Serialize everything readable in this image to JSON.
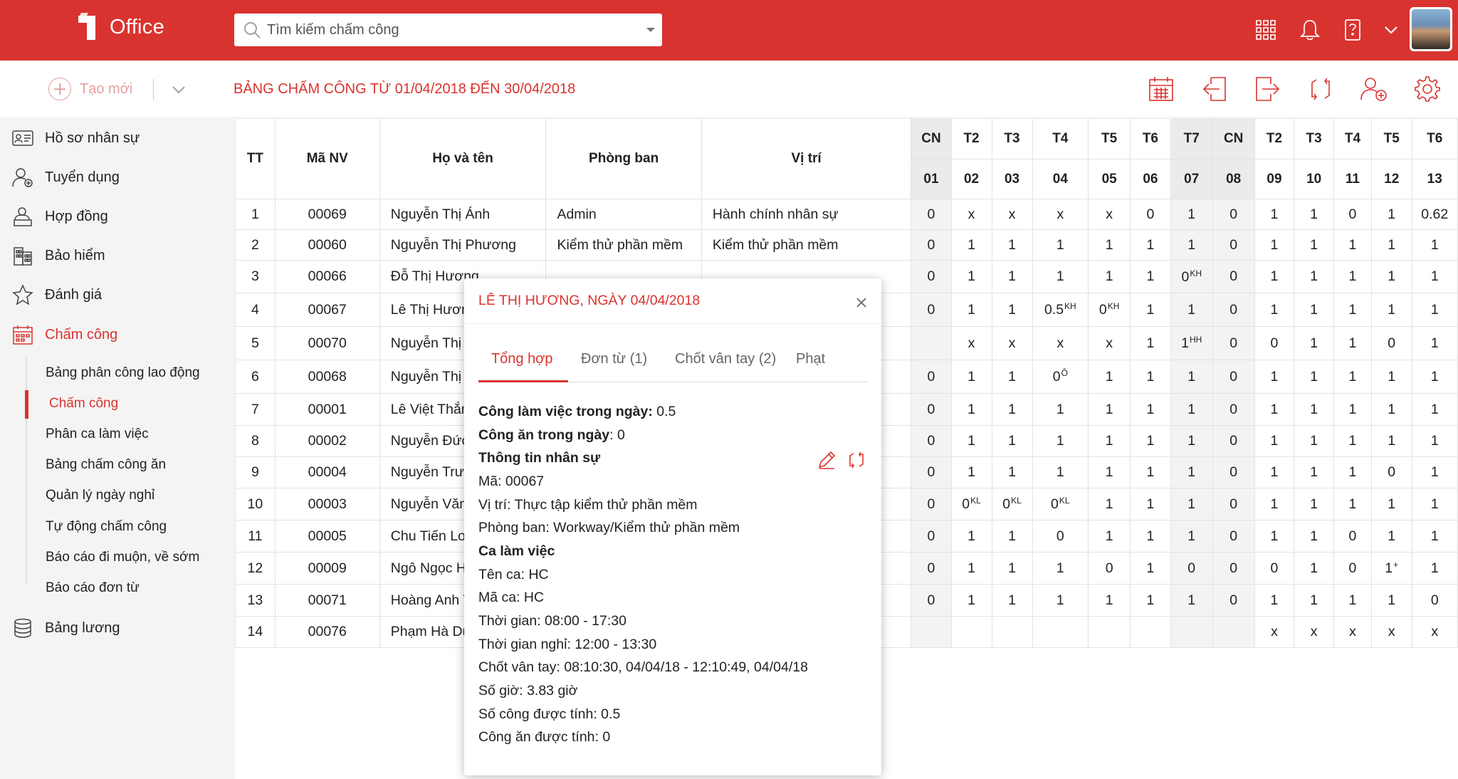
{
  "app": {
    "logo_text": "Office",
    "logo_mark": "1"
  },
  "colors": {
    "brand": "#d9332f",
    "sidebar_bg": "#f4f4f4",
    "weekend_bg": "#ebebeb"
  },
  "search": {
    "placeholder": "Tìm kiếm chấm công",
    "value": ""
  },
  "top_icons": [
    "apps-grid-icon",
    "bell-icon",
    "help-icon",
    "chevron-down-icon"
  ],
  "toolbar": {
    "create_label": "Tạo mới",
    "title": "BẢNG CHẤM CÔNG TỪ 01/04/2018 ĐẾN 30/04/2018",
    "icons": [
      "calendar-icon",
      "import-icon",
      "export-icon",
      "sync-icon",
      "add-user-icon",
      "gear-icon"
    ]
  },
  "sidebar": {
    "items": [
      {
        "label": "Hồ sơ nhân sự",
        "icon": "profile-card-icon"
      },
      {
        "label": "Tuyển dụng",
        "icon": "recruit-icon"
      },
      {
        "label": "Hợp đồng",
        "icon": "contract-icon"
      },
      {
        "label": "Bảo hiểm",
        "icon": "building-icon"
      },
      {
        "label": "Đánh giá",
        "icon": "star-icon"
      },
      {
        "label": "Chấm công",
        "icon": "calendar-icon"
      },
      {
        "label": "Bảng lương",
        "icon": "coins-icon"
      }
    ],
    "sub_items": [
      "Bảng phân công lao động",
      "Chấm công",
      "Phân ca làm việc",
      "Bảng chấm công ăn",
      "Quản lý ngày nghỉ",
      "Tự động chấm công",
      "Báo cáo đi muộn, về sớm",
      "Báo cáo đơn từ"
    ]
  },
  "table": {
    "headers": {
      "tt": "TT",
      "code": "Mã NV",
      "name": "Họ và tên",
      "dept": "Phòng ban",
      "position": "Vị trí"
    },
    "days": [
      {
        "dow": "CN",
        "num": "01",
        "weekend": true
      },
      {
        "dow": "T2",
        "num": "02",
        "weekend": false
      },
      {
        "dow": "T3",
        "num": "03",
        "weekend": false
      },
      {
        "dow": "T4",
        "num": "04",
        "weekend": false
      },
      {
        "dow": "T5",
        "num": "05",
        "weekend": false
      },
      {
        "dow": "T6",
        "num": "06",
        "weekend": false
      },
      {
        "dow": "T7",
        "num": "07",
        "weekend": true
      },
      {
        "dow": "CN",
        "num": "08",
        "weekend": true
      },
      {
        "dow": "T2",
        "num": "09",
        "weekend": false
      },
      {
        "dow": "T3",
        "num": "10",
        "weekend": false
      },
      {
        "dow": "T4",
        "num": "11",
        "weekend": false
      },
      {
        "dow": "T5",
        "num": "12",
        "weekend": false
      },
      {
        "dow": "T6",
        "num": "13",
        "weekend": false
      }
    ],
    "rows": [
      {
        "tt": "1",
        "code": "00069",
        "name": "Nguyễn Thị Ánh",
        "dept": "Admin",
        "position": "Hành chính nhân sự",
        "cells": [
          [
            "0",
            ""
          ],
          [
            "x",
            ""
          ],
          [
            "x",
            ""
          ],
          [
            "x",
            ""
          ],
          [
            "x",
            ""
          ],
          [
            "0",
            ""
          ],
          [
            "1",
            ""
          ],
          [
            "0",
            ""
          ],
          [
            "1",
            ""
          ],
          [
            "1",
            ""
          ],
          [
            "0",
            ""
          ],
          [
            "1",
            ""
          ],
          [
            "0.62",
            ""
          ]
        ]
      },
      {
        "tt": "2",
        "code": "00060",
        "name": "Nguyễn Thị Phương",
        "dept": "Kiểm thử phần mềm",
        "position": "Kiểm thử phần mềm",
        "cells": [
          [
            "0",
            ""
          ],
          [
            "1",
            ""
          ],
          [
            "1",
            ""
          ],
          [
            "1",
            ""
          ],
          [
            "1",
            ""
          ],
          [
            "1",
            ""
          ],
          [
            "1",
            ""
          ],
          [
            "0",
            ""
          ],
          [
            "1",
            ""
          ],
          [
            "1",
            ""
          ],
          [
            "1",
            ""
          ],
          [
            "1",
            ""
          ],
          [
            "1",
            ""
          ]
        ]
      },
      {
        "tt": "3",
        "code": "00066",
        "name": "Đỗ Thị Hương",
        "dept": "",
        "position": "",
        "cells": [
          [
            "0",
            ""
          ],
          [
            "1",
            ""
          ],
          [
            "1",
            ""
          ],
          [
            "1",
            ""
          ],
          [
            "1",
            ""
          ],
          [
            "1",
            ""
          ],
          [
            "0",
            "KH"
          ],
          [
            "0",
            ""
          ],
          [
            "1",
            ""
          ],
          [
            "1",
            ""
          ],
          [
            "1",
            ""
          ],
          [
            "1",
            ""
          ],
          [
            "1",
            ""
          ]
        ]
      },
      {
        "tt": "4",
        "code": "00067",
        "name": "Lê Thị Hương",
        "dept": "",
        "position": "",
        "cells": [
          [
            "0",
            ""
          ],
          [
            "1",
            ""
          ],
          [
            "1",
            ""
          ],
          [
            "0.5",
            "KH"
          ],
          [
            "0",
            "KH"
          ],
          [
            "1",
            ""
          ],
          [
            "1",
            ""
          ],
          [
            "0",
            ""
          ],
          [
            "1",
            ""
          ],
          [
            "1",
            ""
          ],
          [
            "1",
            ""
          ],
          [
            "1",
            ""
          ],
          [
            "1",
            ""
          ]
        ]
      },
      {
        "tt": "5",
        "code": "00070",
        "name": "Nguyễn Thị Trang",
        "dept": "",
        "position": "",
        "cells": [
          [
            "",
            ""
          ],
          [
            "x",
            ""
          ],
          [
            "x",
            ""
          ],
          [
            "x",
            ""
          ],
          [
            "x",
            ""
          ],
          [
            "1",
            ""
          ],
          [
            "1",
            "HH"
          ],
          [
            "0",
            ""
          ],
          [
            "0",
            ""
          ],
          [
            "1",
            ""
          ],
          [
            "1",
            ""
          ],
          [
            "0",
            ""
          ],
          [
            "1",
            ""
          ]
        ]
      },
      {
        "tt": "6",
        "code": "00068",
        "name": "Nguyễn Thị Thùy",
        "dept": "",
        "position": "",
        "cells": [
          [
            "0",
            ""
          ],
          [
            "1",
            ""
          ],
          [
            "1",
            ""
          ],
          [
            "0",
            "Ô"
          ],
          [
            "1",
            ""
          ],
          [
            "1",
            ""
          ],
          [
            "1",
            ""
          ],
          [
            "0",
            ""
          ],
          [
            "1",
            ""
          ],
          [
            "1",
            ""
          ],
          [
            "1",
            ""
          ],
          [
            "1",
            ""
          ],
          [
            "1",
            ""
          ]
        ]
      },
      {
        "tt": "7",
        "code": "00001",
        "name": "Lê Việt Thắng",
        "dept": "",
        "position": "",
        "cells": [
          [
            "0",
            ""
          ],
          [
            "1",
            ""
          ],
          [
            "1",
            ""
          ],
          [
            "1",
            ""
          ],
          [
            "1",
            ""
          ],
          [
            "1",
            ""
          ],
          [
            "1",
            ""
          ],
          [
            "0",
            ""
          ],
          [
            "1",
            ""
          ],
          [
            "1",
            ""
          ],
          [
            "1",
            ""
          ],
          [
            "1",
            ""
          ],
          [
            "1",
            ""
          ]
        ]
      },
      {
        "tt": "8",
        "code": "00002",
        "name": "Nguyễn Đức Minh",
        "dept": "",
        "position": "",
        "cells": [
          [
            "0",
            ""
          ],
          [
            "1",
            ""
          ],
          [
            "1",
            ""
          ],
          [
            "1",
            ""
          ],
          [
            "1",
            ""
          ],
          [
            "1",
            ""
          ],
          [
            "1",
            ""
          ],
          [
            "0",
            ""
          ],
          [
            "1",
            ""
          ],
          [
            "1",
            ""
          ],
          [
            "1",
            ""
          ],
          [
            "1",
            ""
          ],
          [
            "1",
            ""
          ]
        ]
      },
      {
        "tt": "9",
        "code": "00004",
        "name": "Nguyễn Trường Giang",
        "dept": "",
        "position": "",
        "cells": [
          [
            "0",
            ""
          ],
          [
            "1",
            ""
          ],
          [
            "1",
            ""
          ],
          [
            "1",
            ""
          ],
          [
            "1",
            ""
          ],
          [
            "1",
            ""
          ],
          [
            "1",
            ""
          ],
          [
            "0",
            ""
          ],
          [
            "1",
            ""
          ],
          [
            "1",
            ""
          ],
          [
            "1",
            ""
          ],
          [
            "0",
            ""
          ],
          [
            "1",
            ""
          ]
        ]
      },
      {
        "tt": "10",
        "code": "00003",
        "name": "Nguyễn Văn Huy",
        "dept": "",
        "position": "",
        "cells": [
          [
            "0",
            ""
          ],
          [
            "0",
            "KL"
          ],
          [
            "0",
            "KL"
          ],
          [
            "0",
            "KL"
          ],
          [
            "1",
            ""
          ],
          [
            "1",
            ""
          ],
          [
            "1",
            ""
          ],
          [
            "0",
            ""
          ],
          [
            "1",
            ""
          ],
          [
            "1",
            ""
          ],
          [
            "1",
            ""
          ],
          [
            "1",
            ""
          ],
          [
            "1",
            ""
          ]
        ]
      },
      {
        "tt": "11",
        "code": "00005",
        "name": "Chu Tiến Long",
        "dept": "",
        "position": "",
        "cells": [
          [
            "0",
            ""
          ],
          [
            "1",
            ""
          ],
          [
            "1",
            ""
          ],
          [
            "0",
            ""
          ],
          [
            "1",
            ""
          ],
          [
            "1",
            ""
          ],
          [
            "1",
            ""
          ],
          [
            "0",
            ""
          ],
          [
            "1",
            ""
          ],
          [
            "1",
            ""
          ],
          [
            "0",
            ""
          ],
          [
            "1",
            ""
          ],
          [
            "1",
            ""
          ]
        ]
      },
      {
        "tt": "12",
        "code": "00009",
        "name": "Ngô Ngọc Huấn",
        "dept": "",
        "position": "",
        "cells": [
          [
            "0",
            ""
          ],
          [
            "1",
            ""
          ],
          [
            "1",
            ""
          ],
          [
            "1",
            ""
          ],
          [
            "0",
            ""
          ],
          [
            "1",
            ""
          ],
          [
            "0",
            ""
          ],
          [
            "0",
            ""
          ],
          [
            "0",
            ""
          ],
          [
            "1",
            ""
          ],
          [
            "0",
            ""
          ],
          [
            "1",
            "+"
          ],
          [
            "1",
            ""
          ]
        ]
      },
      {
        "tt": "13",
        "code": "00071",
        "name": "Hoàng Anh Tuấn",
        "dept": "",
        "position": "",
        "cells": [
          [
            "0",
            ""
          ],
          [
            "1",
            ""
          ],
          [
            "1",
            ""
          ],
          [
            "1",
            ""
          ],
          [
            "1",
            ""
          ],
          [
            "1",
            ""
          ],
          [
            "1",
            ""
          ],
          [
            "0",
            ""
          ],
          [
            "1",
            ""
          ],
          [
            "1",
            ""
          ],
          [
            "1",
            ""
          ],
          [
            "1",
            ""
          ],
          [
            "0",
            ""
          ]
        ]
      },
      {
        "tt": "14",
        "code": "00076",
        "name": "Phạm Hà Duy",
        "dept": "",
        "position": "",
        "cells": [
          [
            "",
            ""
          ],
          [
            "",
            ""
          ],
          [
            "",
            ""
          ],
          [
            "",
            ""
          ],
          [
            "",
            ""
          ],
          [
            "",
            ""
          ],
          [
            "",
            ""
          ],
          [
            "",
            ""
          ],
          [
            "x",
            ""
          ],
          [
            "x",
            ""
          ],
          [
            "x",
            ""
          ],
          [
            "x",
            ""
          ],
          [
            "x",
            ""
          ]
        ]
      }
    ]
  },
  "popup": {
    "title": "LÊ THỊ HƯƠNG, NGÀY 04/04/2018",
    "tabs": [
      "Tổng hợp",
      "Đơn từ (1)",
      "Chốt vân tay (2)",
      "Phạt"
    ],
    "work_label": "Công làm việc trong ngày:",
    "work_value": " 0.5",
    "meal_label": "Công ăn trong ngày",
    "meal_value": ": 0",
    "staff_heading": "Thông tin nhân sự",
    "staff_code": "Mã: 00067",
    "staff_position": "Vị trí: Thực tập kiểm thử phần mềm",
    "staff_dept": "Phòng ban: Workway/Kiểm thử phần mềm",
    "shift_heading": "Ca làm việc",
    "shift_name": "Tên ca: HC",
    "shift_code": "Mã ca: HC",
    "shift_time": "Thời gian: 08:00 - 17:30",
    "shift_break": "Thời gian nghỉ: 12:00 - 13:30",
    "fingerprint": "Chốt vân tay: 08:10:30, 04/04/18 - 12:10:49, 04/04/18",
    "hours": "Số giờ: 3.83 giờ",
    "counted": "Số công được tính: 0.5",
    "meal_counted": "Công ăn được tính: 0"
  }
}
